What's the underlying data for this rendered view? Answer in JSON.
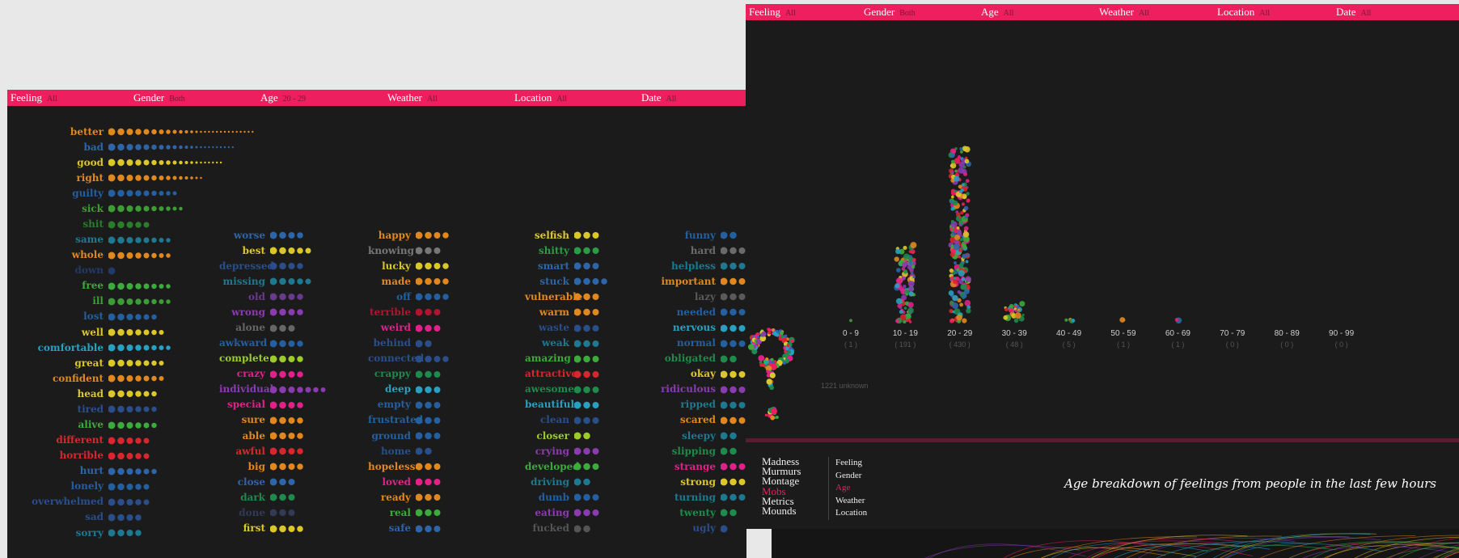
{
  "left_window": {
    "filters": [
      {
        "label": "Feeling",
        "value": "All"
      },
      {
        "label": "Gender",
        "value": "Both"
      },
      {
        "label": "Age",
        "value": "20 - 29"
      },
      {
        "label": "Weather",
        "value": "All"
      },
      {
        "label": "Location",
        "value": "All"
      },
      {
        "label": "Date",
        "value": "All"
      }
    ],
    "columns": [
      [
        [
          "better",
          "#e1871f",
          27
        ],
        [
          "bad",
          "#2e65a8",
          22
        ],
        [
          "good",
          "#dcc72b",
          19
        ],
        [
          "right",
          "#e1871f",
          14
        ],
        [
          "guilty",
          "#245fa0",
          9
        ],
        [
          "sick",
          "#3b9d33",
          10
        ],
        [
          "shit",
          "#2a7d2b",
          5
        ],
        [
          "same",
          "#1e7890",
          8
        ],
        [
          "whole",
          "#e1871f",
          8
        ],
        [
          "down",
          "#213a6a",
          1
        ],
        [
          "free",
          "#3bab3b",
          8
        ],
        [
          "ill",
          "#3b9d33",
          8
        ],
        [
          "lost",
          "#245fa0",
          6
        ],
        [
          "well",
          "#dcc72b",
          7
        ],
        [
          "comfortable",
          "#27a0c2",
          8
        ],
        [
          "great",
          "#dcc72b",
          7
        ],
        [
          "confident",
          "#e1871f",
          7
        ],
        [
          "head",
          "#dcc72b",
          6
        ],
        [
          "tired",
          "#2a4e8a",
          6
        ],
        [
          "alive",
          "#3bab3b",
          6
        ],
        [
          "different",
          "#d9262e",
          5
        ],
        [
          "horrible",
          "#d9262e",
          5
        ],
        [
          "hurt",
          "#2e65a8",
          6
        ],
        [
          "lonely",
          "#245fa0",
          5
        ],
        [
          "overwhelmed",
          "#2a4e8a",
          5
        ],
        [
          "sad",
          "#2a4e8a",
          4
        ],
        [
          "sorry",
          "#1e7890",
          4
        ]
      ],
      [
        [
          "worse",
          "#2e65a8",
          4
        ],
        [
          "best",
          "#dcc72b",
          5
        ],
        [
          "depressed",
          "#2a4e8a",
          4
        ],
        [
          "missing",
          "#1e7890",
          5
        ],
        [
          "old",
          "#6a3a8a",
          4
        ],
        [
          "wrong",
          "#8a3bb0",
          4
        ],
        [
          "alone",
          "#666666",
          3
        ],
        [
          "awkward",
          "#245fa0",
          4
        ],
        [
          "complete",
          "#9acb2b",
          4
        ],
        [
          "crazy",
          "#e0218a",
          4
        ],
        [
          "individual",
          "#8a3bb0",
          7
        ],
        [
          "special",
          "#e0218a",
          4
        ],
        [
          "sure",
          "#e1871f",
          4
        ],
        [
          "able",
          "#e1871f",
          4
        ],
        [
          "awful",
          "#d9262e",
          4
        ],
        [
          "big",
          "#e1871f",
          4
        ],
        [
          "close",
          "#2e65a8",
          3
        ],
        [
          "dark",
          "#1e8a4b",
          3
        ],
        [
          "done",
          "#333a55",
          3
        ],
        [
          "first",
          "#dcc72b",
          4
        ]
      ],
      [
        [
          "happy",
          "#e1871f",
          4
        ],
        [
          "knowing",
          "#777777",
          3
        ],
        [
          "lucky",
          "#dcc72b",
          4
        ],
        [
          "made",
          "#e1871f",
          4
        ],
        [
          "off",
          "#245fa0",
          4
        ],
        [
          "terrible",
          "#b01530",
          3
        ],
        [
          "weird",
          "#e0218a",
          3
        ],
        [
          "behind",
          "#2a4e8a",
          2
        ],
        [
          "connected",
          "#2a4e8a",
          4
        ],
        [
          "crappy",
          "#1e8a4b",
          3
        ],
        [
          "deep",
          "#27a0c2",
          3
        ],
        [
          "empty",
          "#245fa0",
          3
        ],
        [
          "frustrated",
          "#245fa0",
          3
        ],
        [
          "ground",
          "#245fa0",
          3
        ],
        [
          "home",
          "#2a4e8a",
          2
        ],
        [
          "hopeless",
          "#e1871f",
          3
        ],
        [
          "loved",
          "#e0218a",
          3
        ],
        [
          "ready",
          "#e1871f",
          3
        ],
        [
          "real",
          "#3bab3b",
          3
        ],
        [
          "safe",
          "#2e65a8",
          3
        ]
      ],
      [
        [
          "selfish",
          "#dcc72b",
          3
        ],
        [
          "shitty",
          "#2a9d44",
          3
        ],
        [
          "smart",
          "#2e65a8",
          3
        ],
        [
          "stuck",
          "#2e65a8",
          4
        ],
        [
          "vulnerable",
          "#e1871f",
          3
        ],
        [
          "warm",
          "#e1871f",
          3
        ],
        [
          "waste",
          "#2a4e8a",
          3
        ],
        [
          "weak",
          "#1e7890",
          3
        ],
        [
          "amazing",
          "#3bab3b",
          3
        ],
        [
          "attractive",
          "#d9262e",
          3
        ],
        [
          "awesome",
          "#1e8a4b",
          3
        ],
        [
          "beautiful",
          "#27a0c2",
          3
        ],
        [
          "clean",
          "#2a4e8a",
          3
        ],
        [
          "closer",
          "#9acb2b",
          2
        ],
        [
          "crying",
          "#8a3bb0",
          3
        ],
        [
          "developed",
          "#3bab3b",
          3
        ],
        [
          "driving",
          "#1e7890",
          2
        ],
        [
          "dumb",
          "#245fa0",
          3
        ],
        [
          "eating",
          "#8a3bb0",
          3
        ],
        [
          "fucked",
          "#555555",
          2
        ]
      ],
      [
        [
          "funny",
          "#245fa0",
          2
        ],
        [
          "hard",
          "#6a6a6a",
          3
        ],
        [
          "helpless",
          "#1e7890",
          3
        ],
        [
          "important",
          "#e1871f",
          3
        ],
        [
          "lazy",
          "#5a5a5a",
          3
        ],
        [
          "needed",
          "#245fa0",
          3
        ],
        [
          "nervous",
          "#27a0c2",
          3
        ],
        [
          "normal",
          "#245fa0",
          3
        ],
        [
          "obligated",
          "#1e8a4b",
          2
        ],
        [
          "okay",
          "#dcc72b",
          3
        ],
        [
          "ridiculous",
          "#8a3bb0",
          3
        ],
        [
          "ripped",
          "#1e7890",
          3
        ],
        [
          "scared",
          "#e1871f",
          3
        ],
        [
          "sleepy",
          "#1e7890",
          2
        ],
        [
          "slipping",
          "#1e8a4b",
          2
        ],
        [
          "strange",
          "#e0218a",
          3
        ],
        [
          "strong",
          "#dcc72b",
          3
        ],
        [
          "turning",
          "#1e7890",
          3
        ],
        [
          "twenty",
          "#1e8a4b",
          2
        ],
        [
          "ugly",
          "#2a4e8a",
          1
        ]
      ]
    ]
  },
  "right_window": {
    "filters": [
      {
        "label": "Feeling",
        "value": "All"
      },
      {
        "label": "Gender",
        "value": "Both"
      },
      {
        "label": "Age",
        "value": "All"
      },
      {
        "label": "Weather",
        "value": "All"
      },
      {
        "label": "Location",
        "value": "All"
      },
      {
        "label": "Date",
        "value": "All"
      }
    ],
    "unknown_label": "1221 unknown",
    "caption": "Age breakdown of feelings from people in the last few hours",
    "menu_primary": [
      {
        "label": "Madness",
        "active": false
      },
      {
        "label": "Murmurs",
        "active": false
      },
      {
        "label": "Montage",
        "active": false
      },
      {
        "label": "Mobs",
        "active": true
      },
      {
        "label": "Metrics",
        "active": false
      },
      {
        "label": "Mounds",
        "active": false
      }
    ],
    "menu_secondary": [
      {
        "label": "Feeling",
        "active": false
      },
      {
        "label": "Gender",
        "active": false
      },
      {
        "label": "Age",
        "active": true
      },
      {
        "label": "Weather",
        "active": false
      },
      {
        "label": "Location",
        "active": false
      }
    ],
    "accent": "#ee1f5f"
  },
  "chart_data": {
    "type": "bar",
    "categories": [
      "0 - 9",
      "10 - 19",
      "20 - 29",
      "30 - 39",
      "40 - 49",
      "50 - 59",
      "60 - 69",
      "70 - 79",
      "80 - 89",
      "90 - 99"
    ],
    "values": [
      1,
      191,
      430,
      48,
      5,
      1,
      1,
      0,
      0,
      0
    ],
    "value_labels": [
      "( 1 )",
      "( 191 )",
      "( 430 )",
      "( 48 )",
      "( 5 )",
      "( 1 )",
      "( 1 )",
      "( 0 )",
      "( 0 )",
      "( 0 )"
    ]
  }
}
